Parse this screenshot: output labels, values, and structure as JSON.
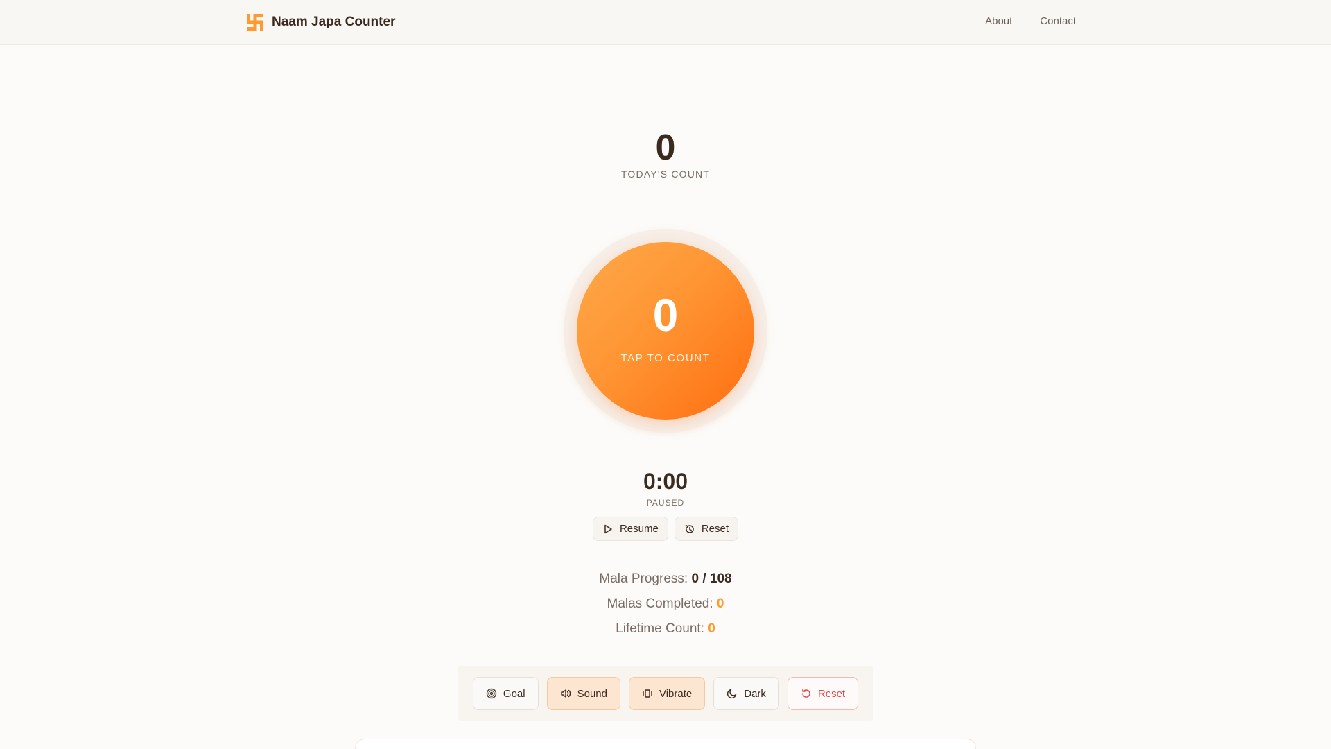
{
  "header": {
    "brand_title": "Naam Japa Counter",
    "nav": {
      "about": "About",
      "contact": "Contact"
    }
  },
  "today": {
    "count": "0",
    "label": "TODAY'S COUNT"
  },
  "counter": {
    "value": "0",
    "label": "TAP TO COUNT"
  },
  "timer": {
    "time": "0:00",
    "status": "PAUSED",
    "resume_label": "Resume",
    "reset_label": "Reset"
  },
  "stats": {
    "mala_progress_label": "Mala Progress:",
    "mala_progress_value": "0 / 108",
    "malas_completed_label": "Malas Completed:",
    "malas_completed_value": "0",
    "lifetime_label": "Lifetime Count:",
    "lifetime_value": "0"
  },
  "toolbar": {
    "goal": "Goal",
    "sound": "Sound",
    "vibrate": "Vibrate",
    "dark": "Dark",
    "reset": "Reset"
  },
  "icons": {
    "logo": "swastika-icon",
    "resume": "play-icon",
    "timer_reset": "timer-reset-icon",
    "goal": "target-icon",
    "sound": "speaker-icon",
    "vibrate": "vibrate-icon",
    "dark": "moon-icon",
    "reset": "rotate-ccw-icon"
  },
  "colors": {
    "accent": "#ff9533",
    "accent_dark": "#ff6d0f",
    "danger": "#e5484d",
    "text": "#3a2a1f",
    "muted": "#7a6c62",
    "background": "#fcfbf9"
  }
}
